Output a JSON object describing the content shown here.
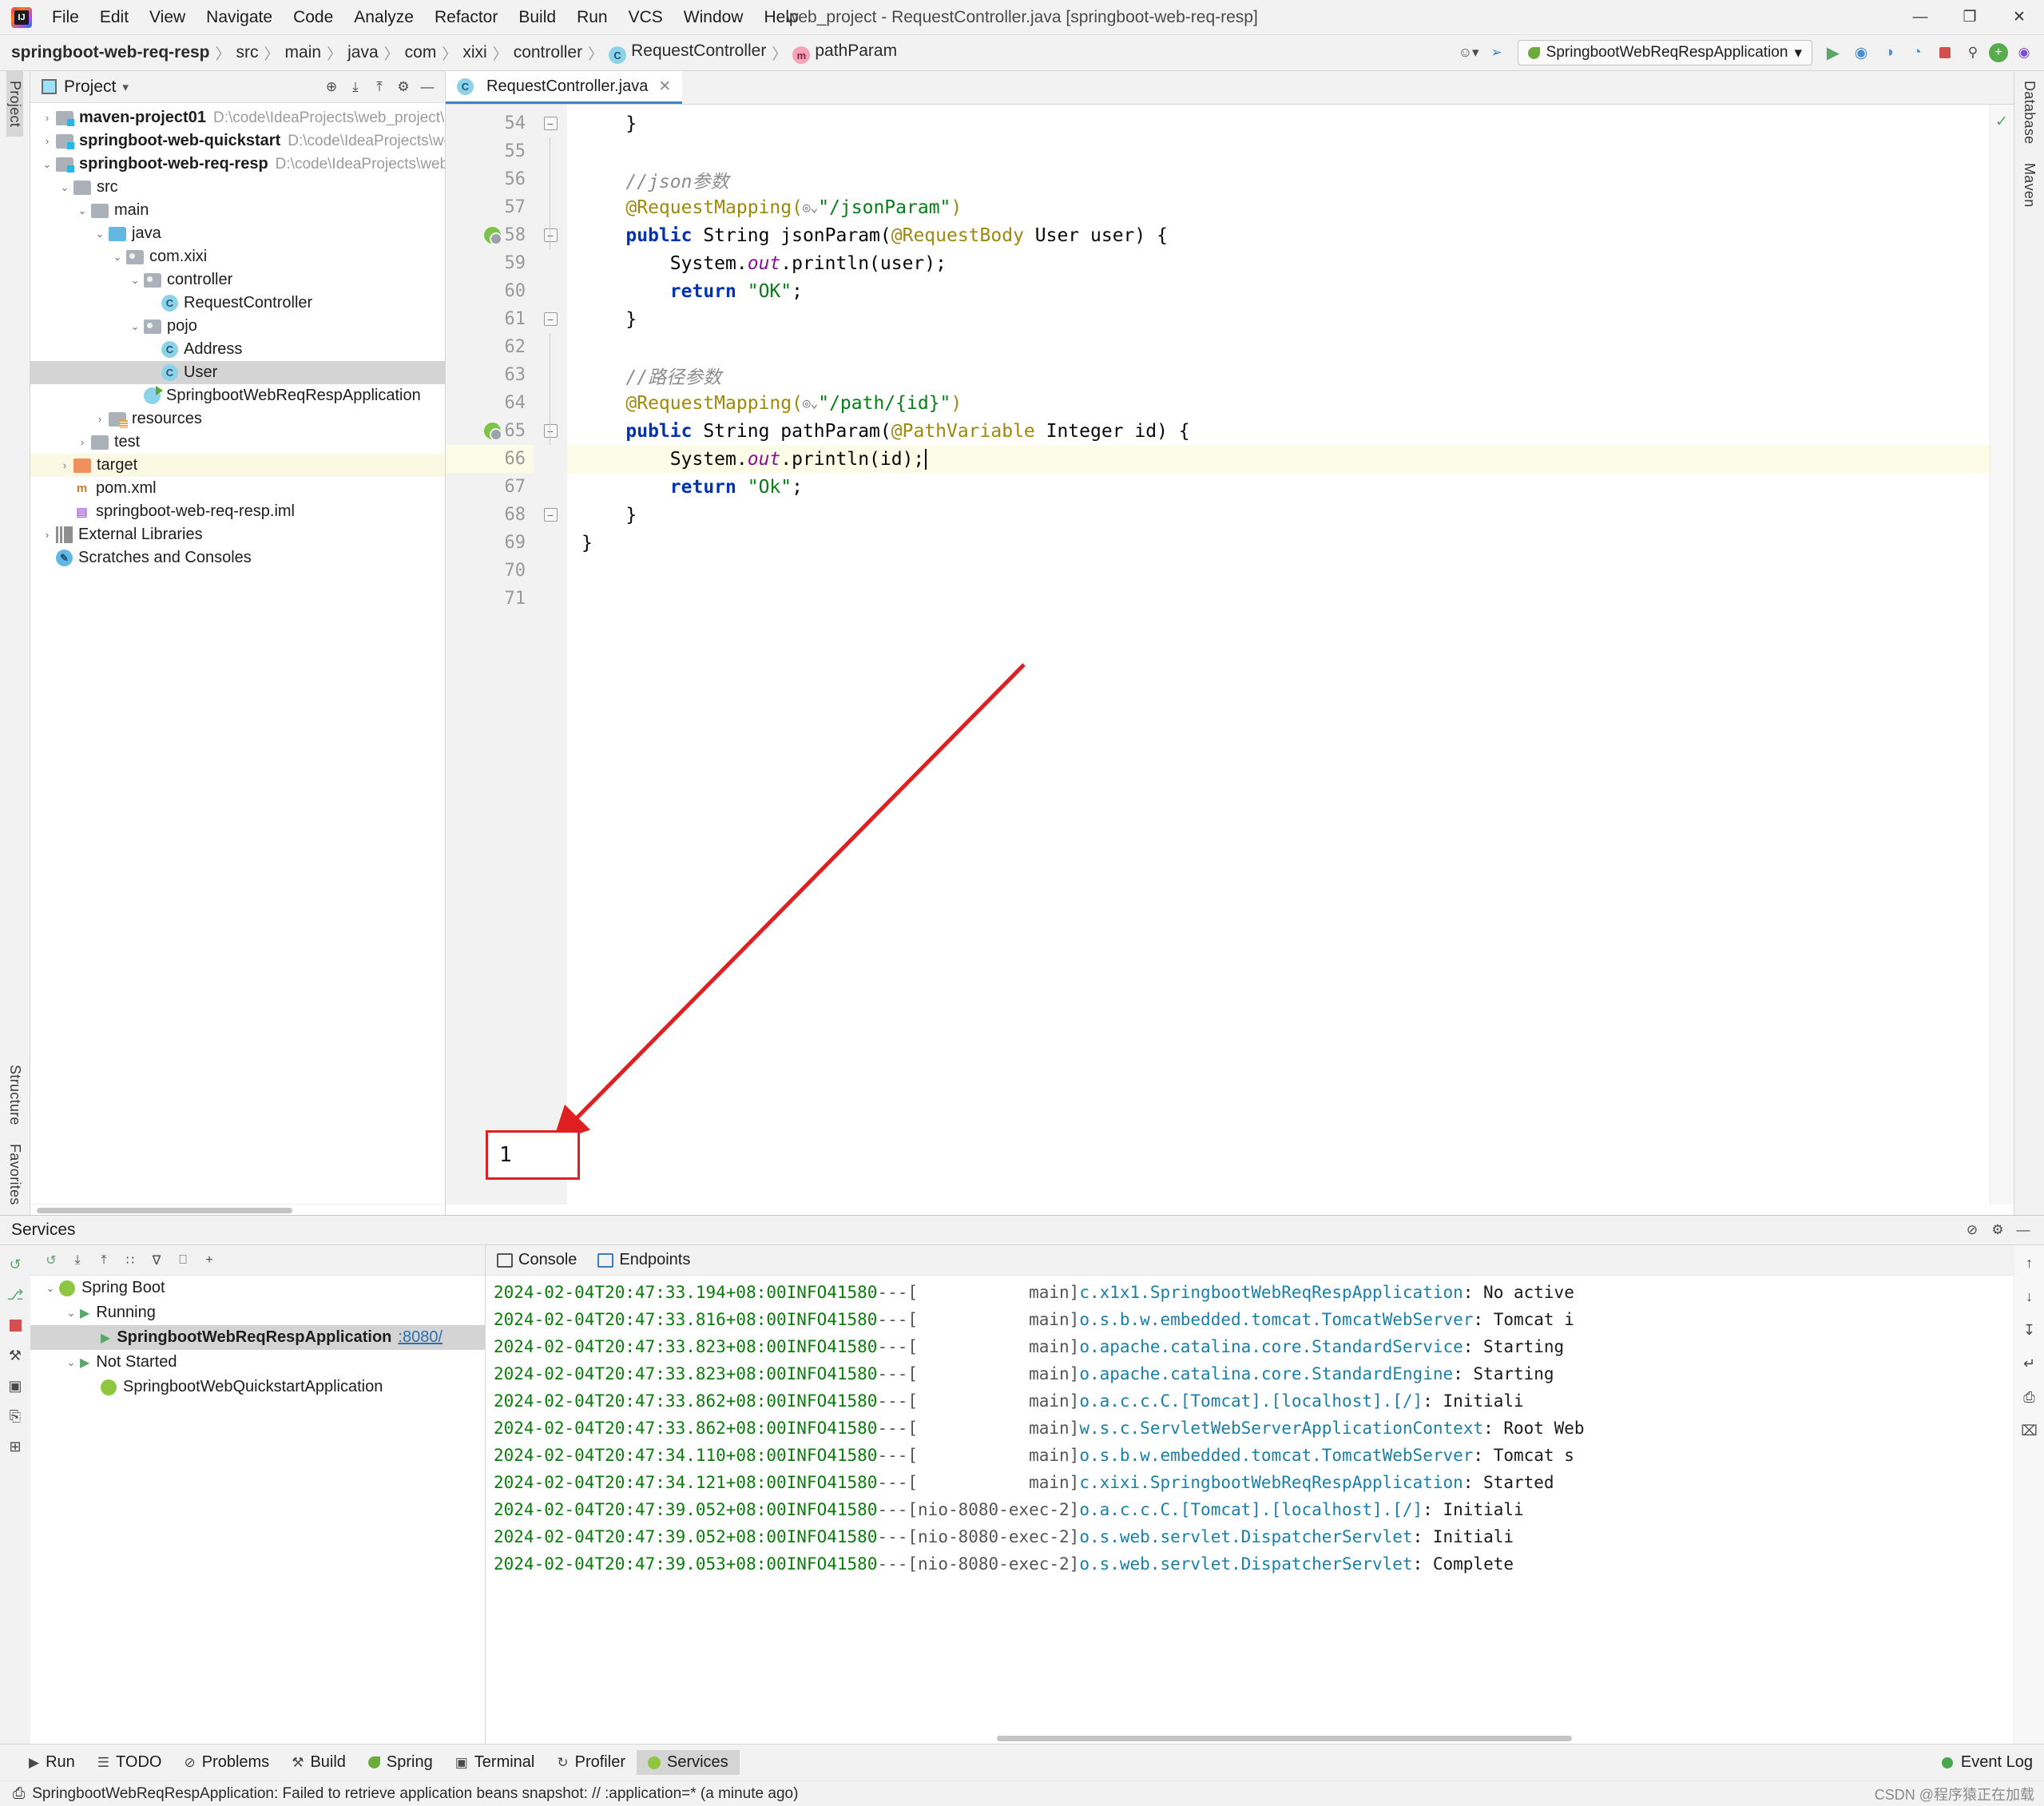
{
  "window": {
    "title": "web_project - RequestController.java [springboot-web-req-resp]",
    "minimize": "—",
    "maximize": "❐",
    "close": "✕"
  },
  "menubar": {
    "items": [
      "File",
      "Edit",
      "View",
      "Navigate",
      "Code",
      "Analyze",
      "Refactor",
      "Build",
      "Run",
      "VCS",
      "Window",
      "Help"
    ]
  },
  "breadcrumb": {
    "items": [
      {
        "label": "springboot-web-req-resp",
        "bold": true,
        "icon": ""
      },
      {
        "label": "src",
        "bold": false,
        "icon": ""
      },
      {
        "label": "main",
        "bold": false,
        "icon": ""
      },
      {
        "label": "java",
        "bold": false,
        "icon": ""
      },
      {
        "label": "com",
        "bold": false,
        "icon": ""
      },
      {
        "label": "xixi",
        "bold": false,
        "icon": ""
      },
      {
        "label": "controller",
        "bold": false,
        "icon": ""
      },
      {
        "label": "RequestController",
        "bold": false,
        "icon": "class-badge"
      },
      {
        "label": "pathParam",
        "bold": false,
        "icon": "method-badge"
      }
    ],
    "separator": "〉"
  },
  "toolbar_right": {
    "profile_icon": "user-icon",
    "hammer_icon": "build-icon",
    "run_config": "SpringbootWebReqRespApplication",
    "dropdown_icon": "▾",
    "run_icon": "▶",
    "debug_icon": "◉",
    "coverage_icon": "◑",
    "profile_run_icon": "◔",
    "stop_icon": "stop-square",
    "search_icon": "⚲",
    "updates_icon": "+",
    "account_icon": "●"
  },
  "project_panel": {
    "title": "Project",
    "dropdown": "▾",
    "tools": [
      "⊕",
      "⤓",
      "⤒",
      "⚙",
      "—"
    ],
    "tree": [
      {
        "depth": 0,
        "arrow": "›",
        "icon": "folder-module",
        "label": "maven-project01",
        "bold": true,
        "path": "D:\\code\\IdeaProjects\\web_project\\",
        "state": ""
      },
      {
        "depth": 0,
        "arrow": "›",
        "icon": "folder-module",
        "label": "springboot-web-quickstart",
        "bold": true,
        "path": "D:\\code\\IdeaProjects\\we",
        "state": ""
      },
      {
        "depth": 0,
        "arrow": "⌄",
        "icon": "folder-module",
        "label": "springboot-web-req-resp",
        "bold": true,
        "path": "D:\\code\\IdeaProjects\\web",
        "state": ""
      },
      {
        "depth": 1,
        "arrow": "⌄",
        "icon": "folder",
        "label": "src",
        "bold": false,
        "path": "",
        "state": ""
      },
      {
        "depth": 2,
        "arrow": "⌄",
        "icon": "folder",
        "label": "main",
        "bold": false,
        "path": "",
        "state": ""
      },
      {
        "depth": 3,
        "arrow": "⌄",
        "icon": "folder-source",
        "label": "java",
        "bold": false,
        "path": "",
        "state": ""
      },
      {
        "depth": 4,
        "arrow": "⌄",
        "icon": "folder-package",
        "label": "com.xixi",
        "bold": false,
        "path": "",
        "state": ""
      },
      {
        "depth": 5,
        "arrow": "⌄",
        "icon": "folder-package",
        "label": "controller",
        "bold": false,
        "path": "",
        "state": ""
      },
      {
        "depth": 6,
        "arrow": "",
        "icon": "java-class",
        "label": "RequestController",
        "bold": false,
        "path": "",
        "state": ""
      },
      {
        "depth": 5,
        "arrow": "⌄",
        "icon": "folder-package",
        "label": "pojo",
        "bold": false,
        "path": "",
        "state": ""
      },
      {
        "depth": 6,
        "arrow": "",
        "icon": "java-class",
        "label": "Address",
        "bold": false,
        "path": "",
        "state": ""
      },
      {
        "depth": 6,
        "arrow": "",
        "icon": "java-class",
        "label": "User",
        "bold": false,
        "path": "",
        "state": "selected"
      },
      {
        "depth": 5,
        "arrow": "",
        "icon": "spring-boot-class",
        "label": "SpringbootWebReqRespApplication",
        "bold": false,
        "path": "",
        "state": ""
      },
      {
        "depth": 3,
        "arrow": "›",
        "icon": "folder-resources",
        "label": "resources",
        "bold": false,
        "path": "",
        "state": ""
      },
      {
        "depth": 2,
        "arrow": "›",
        "icon": "folder",
        "label": "test",
        "bold": false,
        "path": "",
        "state": ""
      },
      {
        "depth": 1,
        "arrow": "›",
        "icon": "folder-target",
        "label": "target",
        "bold": false,
        "path": "",
        "state": "highlight"
      },
      {
        "depth": 1,
        "arrow": "",
        "icon": "maven-pom",
        "label": "pom.xml",
        "bold": false,
        "path": "",
        "state": ""
      },
      {
        "depth": 1,
        "arrow": "",
        "icon": "iml-file",
        "label": "springboot-web-req-resp.iml",
        "bold": false,
        "path": "",
        "state": ""
      },
      {
        "depth": 0,
        "arrow": "›",
        "icon": "libraries",
        "label": "External Libraries",
        "bold": false,
        "path": "",
        "state": ""
      },
      {
        "depth": 0,
        "arrow": "",
        "icon": "scratches",
        "label": "Scratches and Consoles",
        "bold": false,
        "path": "",
        "state": ""
      }
    ]
  },
  "left_strip": {
    "labels": [
      "Project",
      "Structure",
      "Favorites"
    ]
  },
  "right_strip": {
    "labels": [
      "Database",
      "Maven"
    ]
  },
  "editor": {
    "tab": {
      "label": "RequestController.java",
      "close": "✕",
      "icon": "java-class-icon"
    },
    "current_line": 66,
    "lines": [
      {
        "num": 54,
        "gutter_icon": "",
        "fold": "minus",
        "tokens": [
          {
            "t": "pln",
            "v": "    }"
          }
        ]
      },
      {
        "num": 55,
        "gutter_icon": "",
        "fold": "",
        "tokens": []
      },
      {
        "num": 56,
        "gutter_icon": "",
        "fold": "",
        "tokens": [
          {
            "t": "cmt",
            "v": "    //json参数"
          }
        ]
      },
      {
        "num": 57,
        "gutter_icon": "",
        "fold": "",
        "tokens": [
          {
            "t": "ann",
            "v": "    @RequestMapping("
          },
          {
            "t": "gico",
            "v": "◎⌄"
          },
          {
            "t": "str",
            "v": "\"/jsonParam\""
          },
          {
            "t": "ann",
            "v": ")"
          }
        ]
      },
      {
        "num": 58,
        "gutter_icon": "spring-endpoint",
        "fold": "minus",
        "tokens": [
          {
            "t": "k",
            "v": "    public "
          },
          {
            "t": "pln",
            "v": "String "
          },
          {
            "t": "pln",
            "v": "jsonParam("
          },
          {
            "t": "ann",
            "v": "@RequestBody"
          },
          {
            "t": "pln",
            "v": " User user) {"
          }
        ]
      },
      {
        "num": 59,
        "gutter_icon": "",
        "fold": "",
        "tokens": [
          {
            "t": "pln",
            "v": "        System."
          },
          {
            "t": "fld",
            "v": "out"
          },
          {
            "t": "pln",
            "v": ".println(user);"
          }
        ]
      },
      {
        "num": 60,
        "gutter_icon": "",
        "fold": "",
        "tokens": [
          {
            "t": "k",
            "v": "        return "
          },
          {
            "t": "str",
            "v": "\"OK\""
          },
          {
            "t": "pln",
            "v": ";"
          }
        ]
      },
      {
        "num": 61,
        "gutter_icon": "",
        "fold": "minus",
        "tokens": [
          {
            "t": "pln",
            "v": "    }"
          }
        ]
      },
      {
        "num": 62,
        "gutter_icon": "",
        "fold": "",
        "tokens": []
      },
      {
        "num": 63,
        "gutter_icon": "",
        "fold": "",
        "tokens": [
          {
            "t": "cmt",
            "v": "    //路径参数"
          }
        ]
      },
      {
        "num": 64,
        "gutter_icon": "",
        "fold": "",
        "tokens": [
          {
            "t": "ann",
            "v": "    @RequestMapping("
          },
          {
            "t": "gico",
            "v": "◎⌄"
          },
          {
            "t": "str",
            "v": "\"/path/{id}\""
          },
          {
            "t": "ann",
            "v": ")"
          }
        ]
      },
      {
        "num": 65,
        "gutter_icon": "spring-endpoint",
        "fold": "minus",
        "tokens": [
          {
            "t": "k",
            "v": "    public "
          },
          {
            "t": "pln",
            "v": "String "
          },
          {
            "t": "pln",
            "v": "pathParam("
          },
          {
            "t": "ann",
            "v": "@PathVariable"
          },
          {
            "t": "pln",
            "v": " Integer id) {"
          }
        ]
      },
      {
        "num": 66,
        "gutter_icon": "",
        "fold": "",
        "tokens": [
          {
            "t": "pln",
            "v": "        System."
          },
          {
            "t": "fld",
            "v": "out"
          },
          {
            "t": "pln",
            "v": ".println(id);"
          }
        ]
      },
      {
        "num": 67,
        "gutter_icon": "",
        "fold": "",
        "tokens": [
          {
            "t": "k",
            "v": "        return "
          },
          {
            "t": "str",
            "v": "\"Ok\""
          },
          {
            "t": "pln",
            "v": ";"
          }
        ]
      },
      {
        "num": 68,
        "gutter_icon": "",
        "fold": "minus",
        "tokens": [
          {
            "t": "pln",
            "v": "    }"
          }
        ]
      },
      {
        "num": 69,
        "gutter_icon": "",
        "fold": "",
        "tokens": [
          {
            "t": "pln",
            "v": "}"
          }
        ]
      },
      {
        "num": 70,
        "gutter_icon": "",
        "fold": "",
        "tokens": []
      },
      {
        "num": 71,
        "gutter_icon": "",
        "fold": "",
        "tokens": []
      }
    ],
    "inspection_status": "✓"
  },
  "services": {
    "title": "Services",
    "header_tools": [
      "⚙",
      "—"
    ],
    "settings_icon": "⚙",
    "help_icon": "⊘",
    "toolbar": [
      "↺",
      "⤓",
      "⤒",
      "∷",
      "∇",
      "⎕",
      "+"
    ],
    "side_icons": [
      "↺",
      "⎇",
      "stop",
      "⚒",
      "▣",
      "⎘",
      "⊞"
    ],
    "tree": [
      {
        "depth": 0,
        "arrow": "⌄",
        "icon": "spring-boot",
        "label": "Spring Boot",
        "bold": false,
        "suffix": "",
        "state": ""
      },
      {
        "depth": 1,
        "arrow": "⌄",
        "icon": "play",
        "label": "Running",
        "bold": false,
        "suffix": "",
        "state": ""
      },
      {
        "depth": 2,
        "arrow": "",
        "icon": "play",
        "label": "SpringbootWebReqRespApplication",
        "bold": true,
        "suffix": ":8080/",
        "state": "selected"
      },
      {
        "depth": 1,
        "arrow": "⌄",
        "icon": "play-outline",
        "label": "Not Started",
        "bold": false,
        "suffix": "",
        "state": ""
      },
      {
        "depth": 2,
        "arrow": "",
        "icon": "spring-boot",
        "label": "SpringbootWebQuickstartApplication",
        "bold": false,
        "suffix": "",
        "state": ""
      }
    ],
    "console_tabs": [
      {
        "label": "Console",
        "icon": "console-icon",
        "active": true
      },
      {
        "label": "Endpoints",
        "icon": "endpoints-icon",
        "active": false
      }
    ],
    "log_lines": [
      {
        "ts": "2024-02-04T20:47:33.194+08:00",
        "level": "INFO",
        "pid": "41580",
        "dash": "---",
        "thread": "[           main]",
        "cls": "c.x1x1.SpringbootWebReqRespApplication",
        "msg": ": No active"
      },
      {
        "ts": "2024-02-04T20:47:33.816+08:00",
        "level": "INFO",
        "pid": "41580",
        "dash": "---",
        "thread": "[           main]",
        "cls": "o.s.b.w.embedded.tomcat.TomcatWebServer",
        "msg": ": Tomcat i"
      },
      {
        "ts": "2024-02-04T20:47:33.823+08:00",
        "level": "INFO",
        "pid": "41580",
        "dash": "---",
        "thread": "[           main]",
        "cls": "o.apache.catalina.core.StandardService",
        "msg": ": Starting"
      },
      {
        "ts": "2024-02-04T20:47:33.823+08:00",
        "level": "INFO",
        "pid": "41580",
        "dash": "---",
        "thread": "[           main]",
        "cls": "o.apache.catalina.core.StandardEngine",
        "msg": ": Starting"
      },
      {
        "ts": "2024-02-04T20:47:33.862+08:00",
        "level": "INFO",
        "pid": "41580",
        "dash": "---",
        "thread": "[           main]",
        "cls": "o.a.c.c.C.[Tomcat].[localhost].[/]",
        "msg": ": Initiali"
      },
      {
        "ts": "2024-02-04T20:47:33.862+08:00",
        "level": "INFO",
        "pid": "41580",
        "dash": "---",
        "thread": "[           main]",
        "cls": "w.s.c.ServletWebServerApplicationContext",
        "msg": ": Root Web"
      },
      {
        "ts": "2024-02-04T20:47:34.110+08:00",
        "level": "INFO",
        "pid": "41580",
        "dash": "---",
        "thread": "[           main]",
        "cls": "o.s.b.w.embedded.tomcat.TomcatWebServer",
        "msg": ": Tomcat s"
      },
      {
        "ts": "2024-02-04T20:47:34.121+08:00",
        "level": "INFO",
        "pid": "41580",
        "dash": "---",
        "thread": "[           main]",
        "cls": "c.xixi.SpringbootWebReqRespApplication",
        "msg": ": Started "
      },
      {
        "ts": "2024-02-04T20:47:39.052+08:00",
        "level": "INFO",
        "pid": "41580",
        "dash": "---",
        "thread": "[nio-8080-exec-2]",
        "cls": "o.a.c.c.C.[Tomcat].[localhost].[/]",
        "msg": ": Initiali"
      },
      {
        "ts": "2024-02-04T20:47:39.052+08:00",
        "level": "INFO",
        "pid": "41580",
        "dash": "---",
        "thread": "[nio-8080-exec-2]",
        "cls": "o.s.web.servlet.DispatcherServlet",
        "msg": ": Initiali"
      },
      {
        "ts": "2024-02-04T20:47:39.053+08:00",
        "level": "INFO",
        "pid": "41580",
        "dash": "---",
        "thread": "[nio-8080-exec-2]",
        "cls": "o.s.web.servlet.DispatcherServlet",
        "msg": ": Complete"
      }
    ],
    "highlight_output": "1"
  },
  "statusbar": {
    "items": [
      {
        "label": "Run",
        "icon": "▶",
        "active": false
      },
      {
        "label": "TODO",
        "icon": "☰",
        "active": false
      },
      {
        "label": "Problems",
        "icon": "⊘",
        "active": false
      },
      {
        "label": "Build",
        "icon": "⚒",
        "active": false
      },
      {
        "label": "Spring",
        "icon": "leaf",
        "active": false
      },
      {
        "label": "Terminal",
        "icon": "▣",
        "active": false
      },
      {
        "label": "Profiler",
        "icon": "↻",
        "active": false
      },
      {
        "label": "Services",
        "icon": "services-icon",
        "active": true
      }
    ],
    "event_log": "Event Log",
    "event_log_icon": "●"
  },
  "message_bar": {
    "icon": "⎙",
    "text": "SpringbootWebReqRespApplication: Failed to retrieve application beans snapshot: // :application=* (a minute ago)",
    "watermark": "CSDN @程序猿正在加载"
  }
}
